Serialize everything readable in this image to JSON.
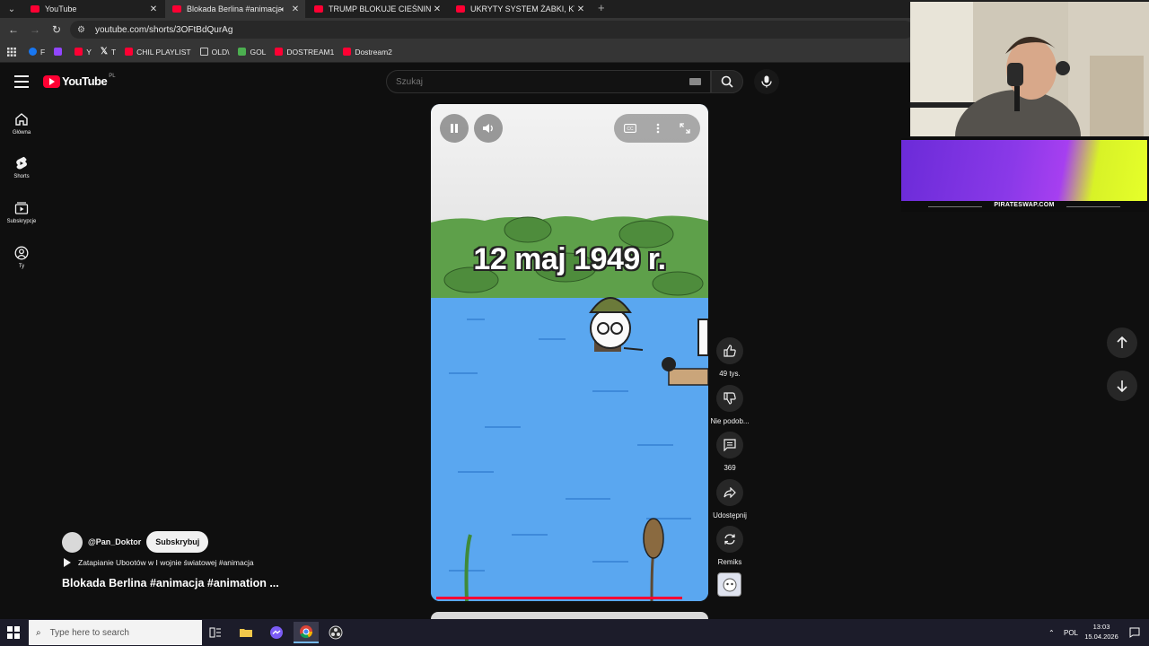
{
  "browser": {
    "tabs": [
      {
        "title": "YouTube",
        "active": false
      },
      {
        "title": "Blokada Berlina #animacja #anim",
        "active": true
      },
      {
        "title": "TRUMP BLOKUJE CIEŚNINĘ, ale",
        "active": false
      },
      {
        "title": "UKRYTY SYSTEM ŻABKI, KTÓRY",
        "active": false
      }
    ],
    "url": "youtube.com/shorts/3OFtBdQurAg",
    "bookmarks": [
      {
        "label": "F",
        "color": "#1877f2"
      },
      {
        "label": "",
        "color": "#9146ff"
      },
      {
        "label": "Y",
        "color": "#ff0033"
      },
      {
        "label": "T",
        "color": "#ffffff"
      },
      {
        "label": "CHIL PLAYLIST",
        "color": "#ff0033"
      },
      {
        "label": "OLD\\",
        "color": "#cccccc"
      },
      {
        "label": "GOL",
        "color": "#4caf50"
      },
      {
        "label": "DOSTREAM1",
        "color": "#ff0033"
      },
      {
        "label": "Dostream2",
        "color": "#ff0033"
      }
    ]
  },
  "youtube": {
    "logo": "YouTube",
    "country": "PL",
    "search_placeholder": "Szukaj",
    "rail": [
      {
        "label": "Główna",
        "icon": "home-icon"
      },
      {
        "label": "Shorts",
        "icon": "shorts-icon"
      },
      {
        "label": "Subskrypcje",
        "icon": "subscriptions-icon"
      },
      {
        "label": "Ty",
        "icon": "you-icon"
      }
    ]
  },
  "short": {
    "overlay_text": "12 maj 1949 r.",
    "progress": 0.92,
    "actions": {
      "like_count": "49 tys.",
      "dislike_label": "Nie podob...",
      "comments_count": "369",
      "share_label": "Udostępnij",
      "remix_label": "Remiks"
    },
    "channel": "@Pan_Doktor",
    "subscribe_label": "Subskrybuj",
    "description": "Zatapianie Ubootów w I wojnie światowej #animacja",
    "title": "Blokada Berlina #animacja #animation ..."
  },
  "overlay": {
    "sponsor_site": "PIRATESWAP.COM"
  },
  "taskbar": {
    "search_placeholder": "Type here to search",
    "language": "POL",
    "time": "13:03",
    "date": "15.04.2026"
  },
  "colors": {
    "yt_red": "#ff0033",
    "background": "#0f0f0f",
    "water": "#5aa7f0",
    "grass": "#5ea04a"
  }
}
